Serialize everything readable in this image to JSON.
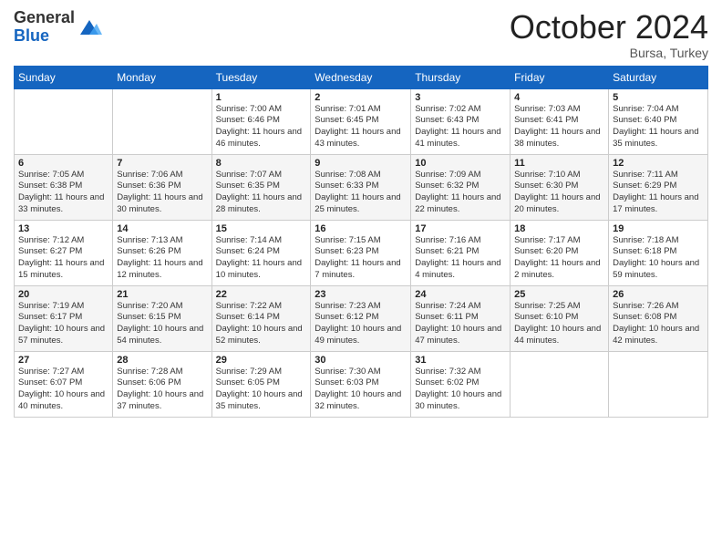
{
  "logo": {
    "general": "General",
    "blue": "Blue"
  },
  "title": "October 2024",
  "location": "Bursa, Turkey",
  "weekdays": [
    "Sunday",
    "Monday",
    "Tuesday",
    "Wednesday",
    "Thursday",
    "Friday",
    "Saturday"
  ],
  "weeks": [
    [
      {
        "day": "",
        "sunrise": "",
        "sunset": "",
        "daylight": ""
      },
      {
        "day": "",
        "sunrise": "",
        "sunset": "",
        "daylight": ""
      },
      {
        "day": "1",
        "sunrise": "Sunrise: 7:00 AM",
        "sunset": "Sunset: 6:46 PM",
        "daylight": "Daylight: 11 hours and 46 minutes."
      },
      {
        "day": "2",
        "sunrise": "Sunrise: 7:01 AM",
        "sunset": "Sunset: 6:45 PM",
        "daylight": "Daylight: 11 hours and 43 minutes."
      },
      {
        "day": "3",
        "sunrise": "Sunrise: 7:02 AM",
        "sunset": "Sunset: 6:43 PM",
        "daylight": "Daylight: 11 hours and 41 minutes."
      },
      {
        "day": "4",
        "sunrise": "Sunrise: 7:03 AM",
        "sunset": "Sunset: 6:41 PM",
        "daylight": "Daylight: 11 hours and 38 minutes."
      },
      {
        "day": "5",
        "sunrise": "Sunrise: 7:04 AM",
        "sunset": "Sunset: 6:40 PM",
        "daylight": "Daylight: 11 hours and 35 minutes."
      }
    ],
    [
      {
        "day": "6",
        "sunrise": "Sunrise: 7:05 AM",
        "sunset": "Sunset: 6:38 PM",
        "daylight": "Daylight: 11 hours and 33 minutes."
      },
      {
        "day": "7",
        "sunrise": "Sunrise: 7:06 AM",
        "sunset": "Sunset: 6:36 PM",
        "daylight": "Daylight: 11 hours and 30 minutes."
      },
      {
        "day": "8",
        "sunrise": "Sunrise: 7:07 AM",
        "sunset": "Sunset: 6:35 PM",
        "daylight": "Daylight: 11 hours and 28 minutes."
      },
      {
        "day": "9",
        "sunrise": "Sunrise: 7:08 AM",
        "sunset": "Sunset: 6:33 PM",
        "daylight": "Daylight: 11 hours and 25 minutes."
      },
      {
        "day": "10",
        "sunrise": "Sunrise: 7:09 AM",
        "sunset": "Sunset: 6:32 PM",
        "daylight": "Daylight: 11 hours and 22 minutes."
      },
      {
        "day": "11",
        "sunrise": "Sunrise: 7:10 AM",
        "sunset": "Sunset: 6:30 PM",
        "daylight": "Daylight: 11 hours and 20 minutes."
      },
      {
        "day": "12",
        "sunrise": "Sunrise: 7:11 AM",
        "sunset": "Sunset: 6:29 PM",
        "daylight": "Daylight: 11 hours and 17 minutes."
      }
    ],
    [
      {
        "day": "13",
        "sunrise": "Sunrise: 7:12 AM",
        "sunset": "Sunset: 6:27 PM",
        "daylight": "Daylight: 11 hours and 15 minutes."
      },
      {
        "day": "14",
        "sunrise": "Sunrise: 7:13 AM",
        "sunset": "Sunset: 6:26 PM",
        "daylight": "Daylight: 11 hours and 12 minutes."
      },
      {
        "day": "15",
        "sunrise": "Sunrise: 7:14 AM",
        "sunset": "Sunset: 6:24 PM",
        "daylight": "Daylight: 11 hours and 10 minutes."
      },
      {
        "day": "16",
        "sunrise": "Sunrise: 7:15 AM",
        "sunset": "Sunset: 6:23 PM",
        "daylight": "Daylight: 11 hours and 7 minutes."
      },
      {
        "day": "17",
        "sunrise": "Sunrise: 7:16 AM",
        "sunset": "Sunset: 6:21 PM",
        "daylight": "Daylight: 11 hours and 4 minutes."
      },
      {
        "day": "18",
        "sunrise": "Sunrise: 7:17 AM",
        "sunset": "Sunset: 6:20 PM",
        "daylight": "Daylight: 11 hours and 2 minutes."
      },
      {
        "day": "19",
        "sunrise": "Sunrise: 7:18 AM",
        "sunset": "Sunset: 6:18 PM",
        "daylight": "Daylight: 10 hours and 59 minutes."
      }
    ],
    [
      {
        "day": "20",
        "sunrise": "Sunrise: 7:19 AM",
        "sunset": "Sunset: 6:17 PM",
        "daylight": "Daylight: 10 hours and 57 minutes."
      },
      {
        "day": "21",
        "sunrise": "Sunrise: 7:20 AM",
        "sunset": "Sunset: 6:15 PM",
        "daylight": "Daylight: 10 hours and 54 minutes."
      },
      {
        "day": "22",
        "sunrise": "Sunrise: 7:22 AM",
        "sunset": "Sunset: 6:14 PM",
        "daylight": "Daylight: 10 hours and 52 minutes."
      },
      {
        "day": "23",
        "sunrise": "Sunrise: 7:23 AM",
        "sunset": "Sunset: 6:12 PM",
        "daylight": "Daylight: 10 hours and 49 minutes."
      },
      {
        "day": "24",
        "sunrise": "Sunrise: 7:24 AM",
        "sunset": "Sunset: 6:11 PM",
        "daylight": "Daylight: 10 hours and 47 minutes."
      },
      {
        "day": "25",
        "sunrise": "Sunrise: 7:25 AM",
        "sunset": "Sunset: 6:10 PM",
        "daylight": "Daylight: 10 hours and 44 minutes."
      },
      {
        "day": "26",
        "sunrise": "Sunrise: 7:26 AM",
        "sunset": "Sunset: 6:08 PM",
        "daylight": "Daylight: 10 hours and 42 minutes."
      }
    ],
    [
      {
        "day": "27",
        "sunrise": "Sunrise: 7:27 AM",
        "sunset": "Sunset: 6:07 PM",
        "daylight": "Daylight: 10 hours and 40 minutes."
      },
      {
        "day": "28",
        "sunrise": "Sunrise: 7:28 AM",
        "sunset": "Sunset: 6:06 PM",
        "daylight": "Daylight: 10 hours and 37 minutes."
      },
      {
        "day": "29",
        "sunrise": "Sunrise: 7:29 AM",
        "sunset": "Sunset: 6:05 PM",
        "daylight": "Daylight: 10 hours and 35 minutes."
      },
      {
        "day": "30",
        "sunrise": "Sunrise: 7:30 AM",
        "sunset": "Sunset: 6:03 PM",
        "daylight": "Daylight: 10 hours and 32 minutes."
      },
      {
        "day": "31",
        "sunrise": "Sunrise: 7:32 AM",
        "sunset": "Sunset: 6:02 PM",
        "daylight": "Daylight: 10 hours and 30 minutes."
      },
      {
        "day": "",
        "sunrise": "",
        "sunset": "",
        "daylight": ""
      },
      {
        "day": "",
        "sunrise": "",
        "sunset": "",
        "daylight": ""
      }
    ]
  ]
}
